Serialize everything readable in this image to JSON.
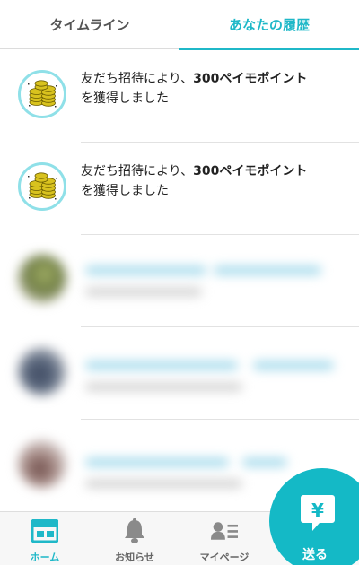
{
  "tabs": [
    {
      "label": "タイムライン",
      "active": false
    },
    {
      "label": "あなたの履歴",
      "active": true
    }
  ],
  "history": [
    {
      "icon": "coins-icon",
      "text_before": "友だち招待により、",
      "text_bold": "300ペイモポイント",
      "text_after": "を獲得しました"
    },
    {
      "icon": "coins-icon",
      "text_before": "友だち招待により、",
      "text_bold": "300ペイモポイント",
      "text_after": "を獲得しました"
    }
  ],
  "bottom_nav": [
    {
      "label": "ホーム",
      "icon": "home-icon",
      "active": true
    },
    {
      "label": "お知らせ",
      "icon": "bell-icon",
      "active": false
    },
    {
      "label": "マイページ",
      "icon": "profile-card-icon",
      "active": false
    }
  ],
  "send_button": {
    "label": "送る",
    "icon": "yen-bubble-icon",
    "symbol": "¥"
  },
  "colors": {
    "accent": "#1fb8c8",
    "fab": "#14b9c6",
    "text": "#222222",
    "inactive": "#666666"
  }
}
